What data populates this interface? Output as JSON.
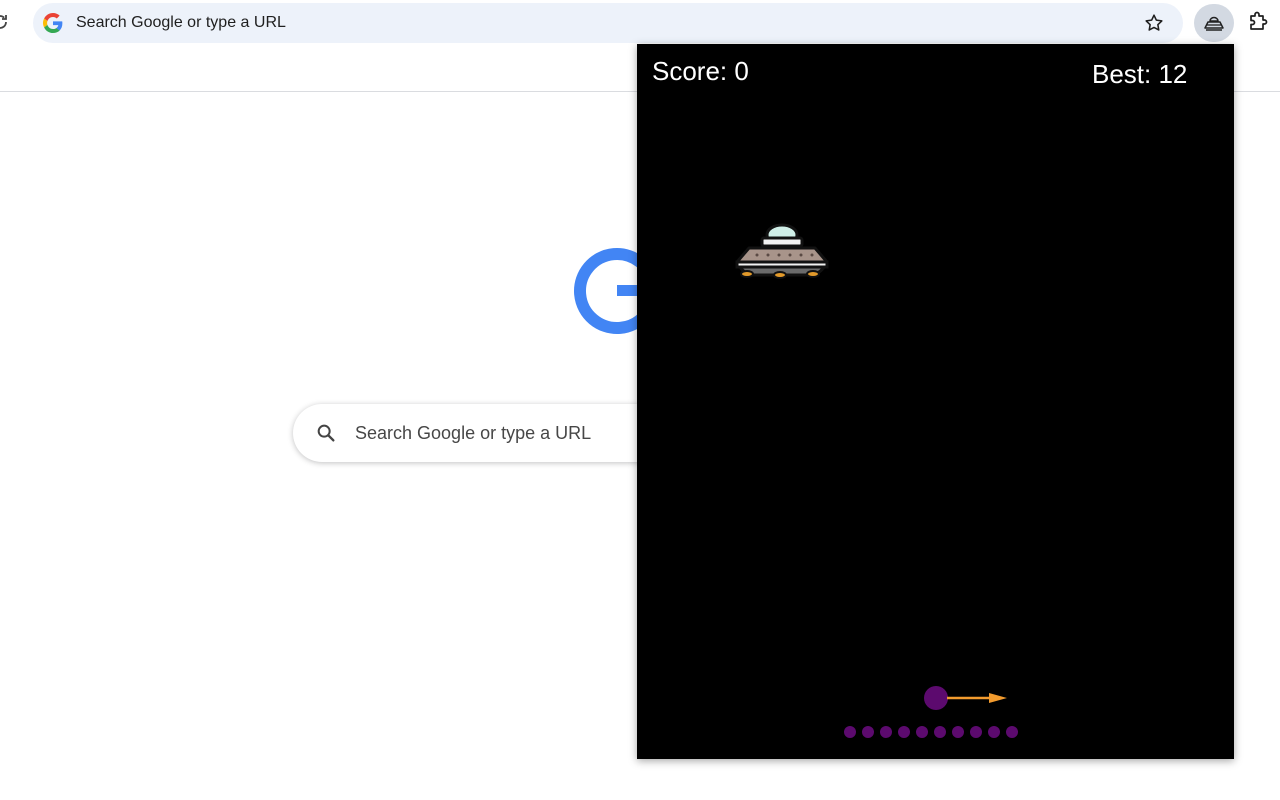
{
  "browser": {
    "omnibox_text": "Search Google or type a URL"
  },
  "ntp": {
    "search_placeholder": "Search Google or type a URL"
  },
  "game": {
    "score_label": "Score: 0",
    "best_label": "Best: 12",
    "score": 0,
    "best": 12,
    "ammo_count": 10,
    "colors": {
      "background": "#000000",
      "text": "#ffffff",
      "player": "#5c0a6e",
      "aim_arrow": "#f29b2e"
    }
  }
}
